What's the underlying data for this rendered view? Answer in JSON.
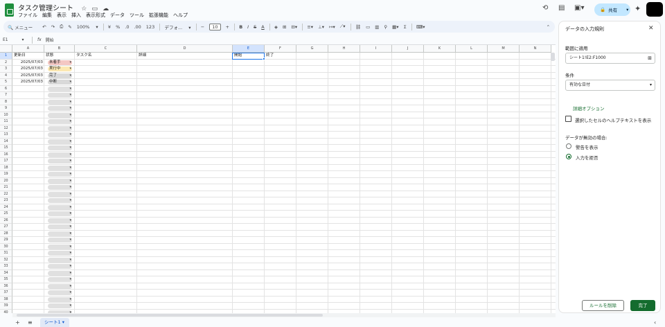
{
  "app": {
    "title": "タスク管理シート",
    "menu": [
      "ファイル",
      "編集",
      "表示",
      "挿入",
      "表示形式",
      "データ",
      "ツール",
      "拡張機能",
      "ヘルプ"
    ],
    "share_label": "共有"
  },
  "toolbar": {
    "search_label": "メニュー",
    "zoom": "100%",
    "currency": "¥",
    "percent": "%",
    "dec_less": ".0",
    "dec_more": ".00",
    "number_format": "123",
    "font": "デフォ...",
    "font_size": "10",
    "bold": "B",
    "italic": "I",
    "strike": "S",
    "text_color": "A"
  },
  "formula": {
    "cell_ref": "E1",
    "fx": "fx",
    "value": "開始"
  },
  "grid": {
    "columns": [
      "A",
      "B",
      "C",
      "D",
      "E",
      "F",
      "G",
      "H",
      "I",
      "J",
      "K",
      "L",
      "M",
      "N"
    ],
    "row_count": 41,
    "header_row": {
      "A": "更新日",
      "B": "状態",
      "C": "タスク名",
      "D": "詳細",
      "E": "開始",
      "F": "終了"
    },
    "data_rows": [
      {
        "date": "2025/07/03",
        "status": "未着手",
        "color": "#f4c7c3"
      },
      {
        "date": "2025/07/03",
        "status": "実行中",
        "color": "#fce8b2"
      },
      {
        "date": "2025/07/03",
        "status": "完了",
        "color": "#d9d9d9"
      },
      {
        "date": "2025/07/03",
        "status": "中断",
        "color": "#d9d9d9"
      }
    ]
  },
  "panel": {
    "title": "データの入力規則",
    "apply_label": "範囲に適用",
    "range_value": "シート1!E2:F1000",
    "criteria_label": "条件",
    "criteria_value": "有効な日付",
    "advanced_label": "詳細オプション",
    "help_text_label": "選択したセルのヘルプテキストを表示",
    "invalid_label": "データが無効の場合:",
    "option_warning": "警告を表示",
    "option_reject": "入力を拒否",
    "selected_option": "reject",
    "delete_button": "ルールを削除",
    "done_button": "完了"
  },
  "sheets": {
    "tabs": [
      "シート1"
    ]
  },
  "colors": {
    "accent_green": "#146c2e",
    "share_bg": "#c2e7ff",
    "selection_blue": "#d3e3fd"
  }
}
